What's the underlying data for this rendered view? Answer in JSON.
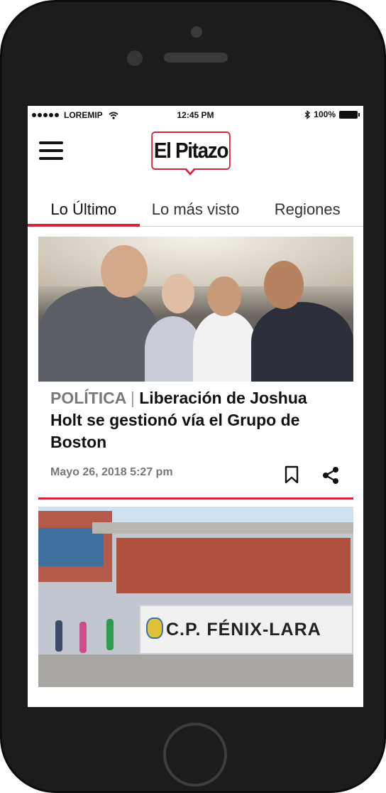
{
  "status_bar": {
    "carrier": "LOREMIP",
    "time": "12:45 PM",
    "battery": "100%"
  },
  "header": {
    "logo_text": "El Pitazo"
  },
  "tabs": [
    {
      "label": "Lo Último",
      "active": true
    },
    {
      "label": "Lo más visto",
      "active": false
    },
    {
      "label": "Regiones",
      "active": false
    }
  ],
  "articles": [
    {
      "category": "POLÍTICA",
      "separator": "|",
      "title": "Liberación de Joshua Holt se gestionó vía el Grupo de Boston",
      "date": "Mayo 26, 2018 5:27 pm"
    },
    {
      "sign_text": "C.P. FÉNIX-LARA"
    }
  ],
  "icons": {
    "menu": "hamburger-icon",
    "bookmark": "bookmark-icon",
    "share": "share-icon"
  },
  "colors": {
    "accent": "#d9243d",
    "text": "#111111",
    "muted": "#777777"
  }
}
